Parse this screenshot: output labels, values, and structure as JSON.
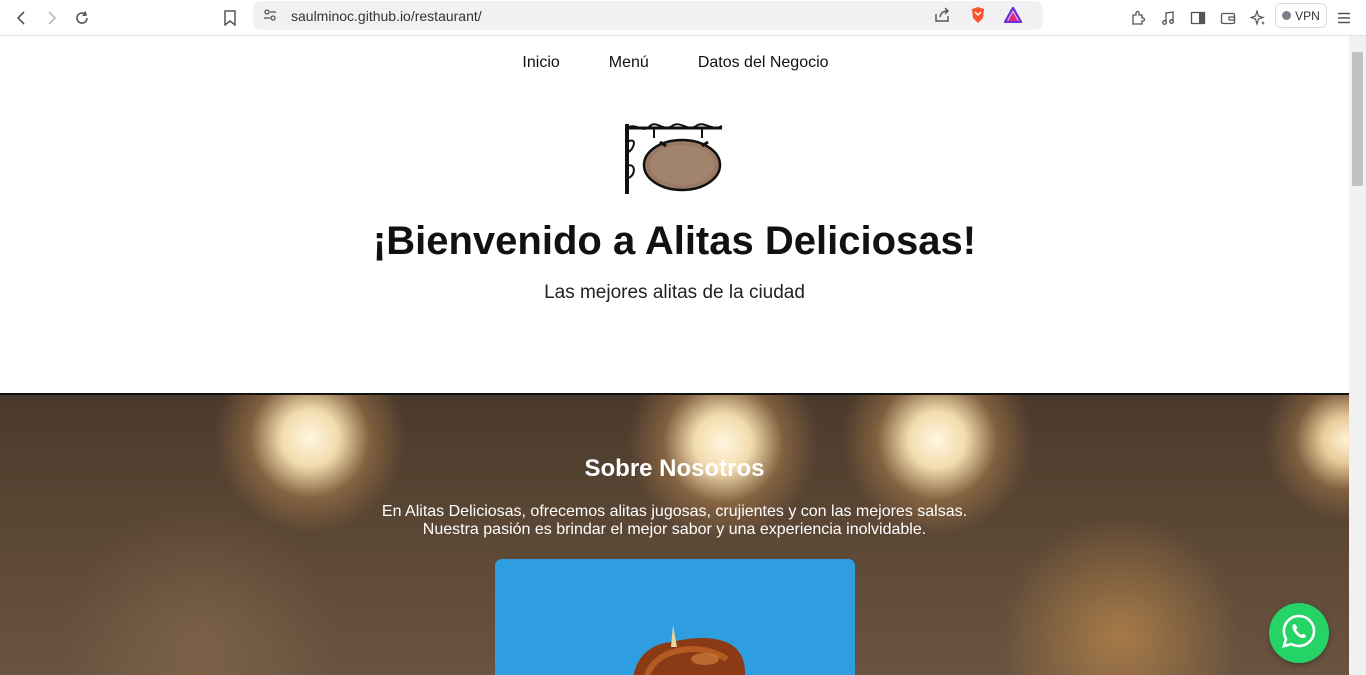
{
  "browser": {
    "url": "saulminoc.github.io/restaurant/",
    "vpn_label": "VPN"
  },
  "nav": {
    "items": [
      "Inicio",
      "Menú",
      "Datos del Negocio"
    ]
  },
  "hero": {
    "title": "¡Bienvenido a Alitas Deliciosas!",
    "subtitle": "Las mejores alitas de la ciudad"
  },
  "about": {
    "title": "Sobre Nosotros",
    "line1": "En Alitas Deliciosas, ofrecemos alitas jugosas, crujientes y con las mejores salsas.",
    "line2": "Nuestra pasión es brindar el mejor sabor y una experiencia inolvidable."
  },
  "colors": {
    "whatsapp": "#25d366",
    "card_bg": "#2f9ee0"
  }
}
